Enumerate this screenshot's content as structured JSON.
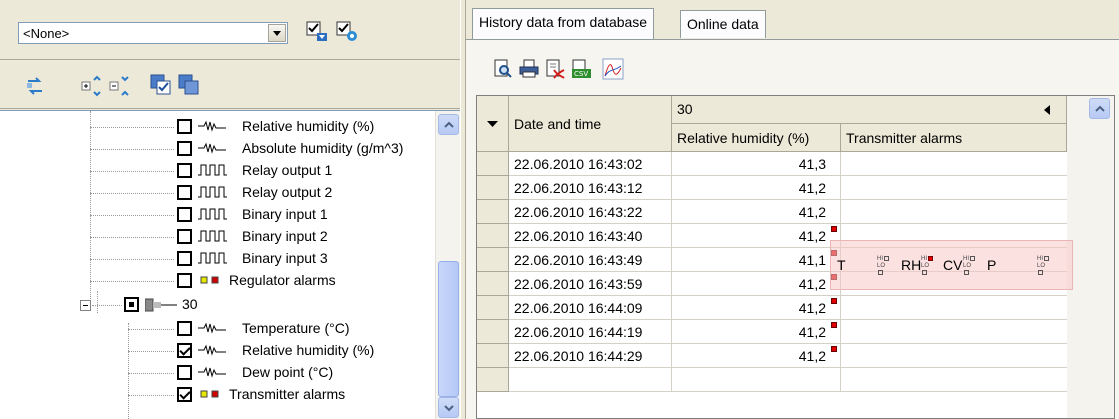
{
  "left": {
    "filter_combo": {
      "value": "<None>"
    },
    "toolbar2_icons": [
      "refresh-icon",
      "expand-all-icon",
      "collapse-all-icon",
      "check-all-icon",
      "uncheck-all-icon"
    ],
    "tree_items": [
      {
        "label": "Relative humidity (%)",
        "kind": "analog",
        "checked": false
      },
      {
        "label": "Absolute humidity (g/m^3)",
        "kind": "analog",
        "checked": false
      },
      {
        "label": "Relay output 1",
        "kind": "binary",
        "checked": false
      },
      {
        "label": "Relay output 2",
        "kind": "binary",
        "checked": false
      },
      {
        "label": "Binary input 1",
        "kind": "binary",
        "checked": false
      },
      {
        "label": "Binary input 2",
        "kind": "binary",
        "checked": false
      },
      {
        "label": "Binary input 3",
        "kind": "binary",
        "checked": false
      },
      {
        "label": "Regulator alarms",
        "kind": "alarm",
        "checked": false
      },
      {
        "label": "30",
        "kind": "device",
        "checked": true
      },
      {
        "label": "Temperature (°C)",
        "kind": "analog",
        "checked": false
      },
      {
        "label": "Relative humidity (%)",
        "kind": "analog",
        "checked": true
      },
      {
        "label": "Dew point (°C)",
        "kind": "analog",
        "checked": false
      },
      {
        "label": "Transmitter alarms",
        "kind": "alarm",
        "checked": true
      }
    ]
  },
  "right": {
    "tabs": [
      {
        "label": "History data from database",
        "active": true
      },
      {
        "label": "Online data",
        "active": false
      }
    ],
    "toolbar_icons": [
      "preview-icon",
      "print-icon",
      "export-pdf-icon",
      "export-csv-icon",
      "chart-icon"
    ],
    "grid": {
      "device_header": "30",
      "col_datetime": "Date and time",
      "col_rh": "Relative humidity (%)",
      "col_alarms": "Transmitter alarms",
      "rows": [
        {
          "datetime": "22.06.2010 16:43:02",
          "rh": "41,3",
          "alarm": false
        },
        {
          "datetime": "22.06.2010 16:43:12",
          "rh": "41,2",
          "alarm": false
        },
        {
          "datetime": "22.06.2010 16:43:22",
          "rh": "41,2",
          "alarm": false
        },
        {
          "datetime": "22.06.2010 16:43:40",
          "rh": "41,2",
          "alarm": true
        },
        {
          "datetime": "22.06.2010 16:43:49",
          "rh": "41,1",
          "alarm": true
        },
        {
          "datetime": "22.06.2010 16:43:59",
          "rh": "41,2",
          "alarm": true
        },
        {
          "datetime": "22.06.2010 16:44:09",
          "rh": "41,2",
          "alarm": true
        },
        {
          "datetime": "22.06.2010 16:44:19",
          "rh": "41,2",
          "alarm": true
        },
        {
          "datetime": "22.06.2010 16:44:29",
          "rh": "41,2",
          "alarm": true
        }
      ]
    },
    "alarm_tooltip": {
      "items": [
        "T",
        "RH",
        "CV",
        "P"
      ],
      "hi": "HI",
      "lo": "LO"
    }
  },
  "colors": {
    "alarm_red": "#e00000",
    "tooltip_bg": "#f6c5c5"
  }
}
